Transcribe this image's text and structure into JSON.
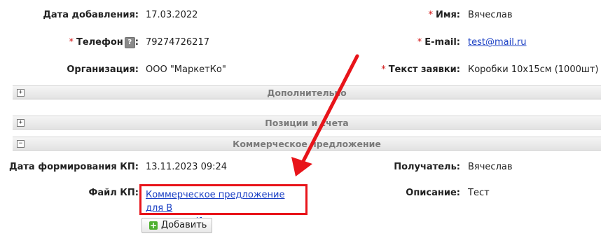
{
  "fields_top": {
    "date_added": {
      "label": "Дата добавления:",
      "value": "17.03.2022"
    },
    "phone": {
      "required_mark": "*",
      "label": "Телефон",
      "help": "?",
      "colon": ":",
      "value": "79274726217"
    },
    "organization": {
      "label": "Организация:",
      "value": "ООО \"МаркетКо\""
    },
    "name": {
      "required_mark": "*",
      "label": "Имя:",
      "value": "Вячеслав"
    },
    "email": {
      "required_mark": "*",
      "label": "E-mail:",
      "value": "test@mail.ru"
    },
    "request_text": {
      "required_mark": "*",
      "label": "Текст заявки:",
      "value": "Коробки 10х15см (1000шт)"
    }
  },
  "sections": [
    {
      "toggle": "+",
      "title": "Дополнительно"
    },
    {
      "toggle": "+",
      "title": "Позиции и счета"
    },
    {
      "toggle": "−",
      "title": "Коммерческое предложение"
    }
  ],
  "commercial_offer": {
    "date_formed": {
      "label": "Дата формирования КП:",
      "value": "13.11.2023 09:24"
    },
    "file": {
      "label": "Файл КП:",
      "value_line1": "Коммерческое предложение для В",
      "value_line2": "ячеслав.pdf"
    },
    "recipient": {
      "label": "Получатель:",
      "value": "Вячеслав"
    },
    "description": {
      "label": "Описание:",
      "value": "Тест"
    },
    "add_button": {
      "label": "Добавить",
      "icon": "plus-icon"
    }
  },
  "colors": {
    "annotation_red": "#e8141a",
    "link_blue": "#1a3fc4",
    "required_red": "#d01010"
  }
}
